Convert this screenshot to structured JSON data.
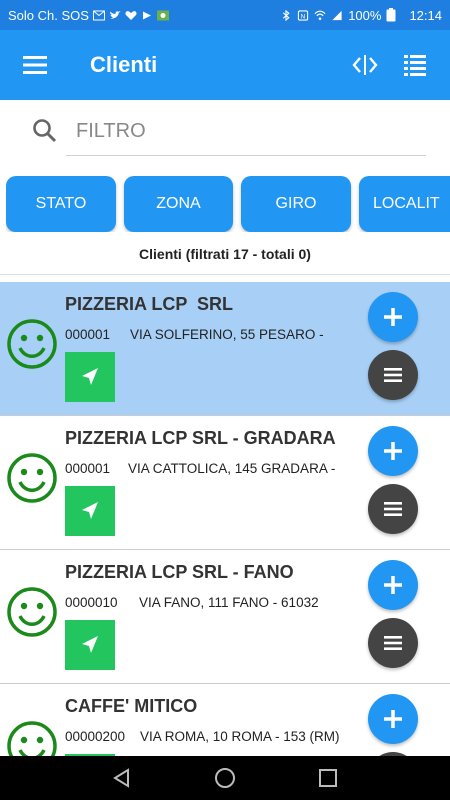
{
  "status_bar": {
    "carrier": "Solo Ch. SOS",
    "battery": "100%",
    "time": "12:14",
    "icons_left": [
      "email-icon",
      "twitter-icon",
      "heart-icon",
      "play-icon",
      "eye-icon"
    ],
    "icons_right": [
      "bluetooth-icon",
      "nfc-icon",
      "wifi-icon",
      "signal-icon",
      "battery-icon"
    ]
  },
  "app_bar": {
    "title": "Clienti",
    "menu_icon": "menu-icon",
    "actions": [
      "code-icon",
      "list-icon"
    ]
  },
  "search": {
    "placeholder": "FILTRO"
  },
  "filters": [
    "STATO",
    "ZONA",
    "GIRO",
    "LOCALIT"
  ],
  "summary": "Clienti (filtrati 17 - totali 0)",
  "clients": [
    {
      "name": "PIZZERIA LCP  SRL",
      "code": "000001",
      "address": "VIA SOLFERINO, 55 PESARO -",
      "selected": true
    },
    {
      "name": "PIZZERIA LCP SRL - GRADARA",
      "code": "000001",
      "address": "VIA CATTOLICA, 145 GRADARA -",
      "selected": false
    },
    {
      "name": "PIZZERIA LCP SRL - FANO",
      "code": "0000010",
      "address": "VIA FANO, 111 FANO - 61032",
      "selected": false
    },
    {
      "name": "CAFFE' MITICO",
      "code": "00000200",
      "address": "VIA ROMA, 10 ROMA - 153 (RM)",
      "selected": false
    }
  ],
  "colors": {
    "primary": "#2196f3",
    "status_bar": "#1e7fe0",
    "selected_row": "#a8d0f7",
    "smiley": "#1a8a1a",
    "nav_button": "#22c55e",
    "more_button": "#444444"
  },
  "nav_bar": [
    "back-icon",
    "home-icon",
    "recents-icon"
  ]
}
